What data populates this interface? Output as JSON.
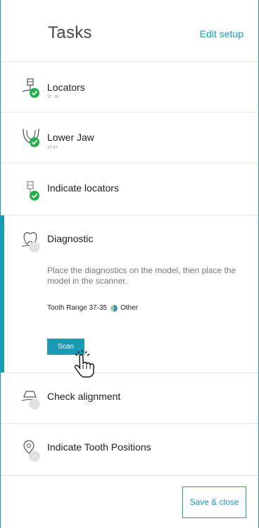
{
  "header": {
    "title": "Tasks",
    "edit_setup_label": "Edit setup"
  },
  "tasks": [
    {
      "label": "Locators",
      "sub": "37, 35",
      "status": "done",
      "icon": "locator-icon"
    },
    {
      "label": "Lower Jaw",
      "sub": "37-47",
      "status": "done",
      "icon": "lower-jaw-icon"
    },
    {
      "label": "Indicate locators",
      "status": "done",
      "icon": "locator-outline-icon"
    },
    {
      "label": "Diagnostic",
      "status": "active",
      "icon": "tooth-icon",
      "description": "Place the diagnostics on the model, then place the model in the scanner.",
      "range_label": "Tooth Range 37-35",
      "range_tag": "Other",
      "scan_label": "Scan"
    },
    {
      "label": "Check alignment",
      "status": "pending",
      "icon": "alignment-icon"
    },
    {
      "label": "Indicate Tooth Positions",
      "status": "pending",
      "icon": "map-pin-icon"
    }
  ],
  "footer": {
    "save_close_label": "Save & close"
  },
  "colors": {
    "accent": "#1a9bb4",
    "done": "#22b14c",
    "pending": "#e3e3e3"
  }
}
